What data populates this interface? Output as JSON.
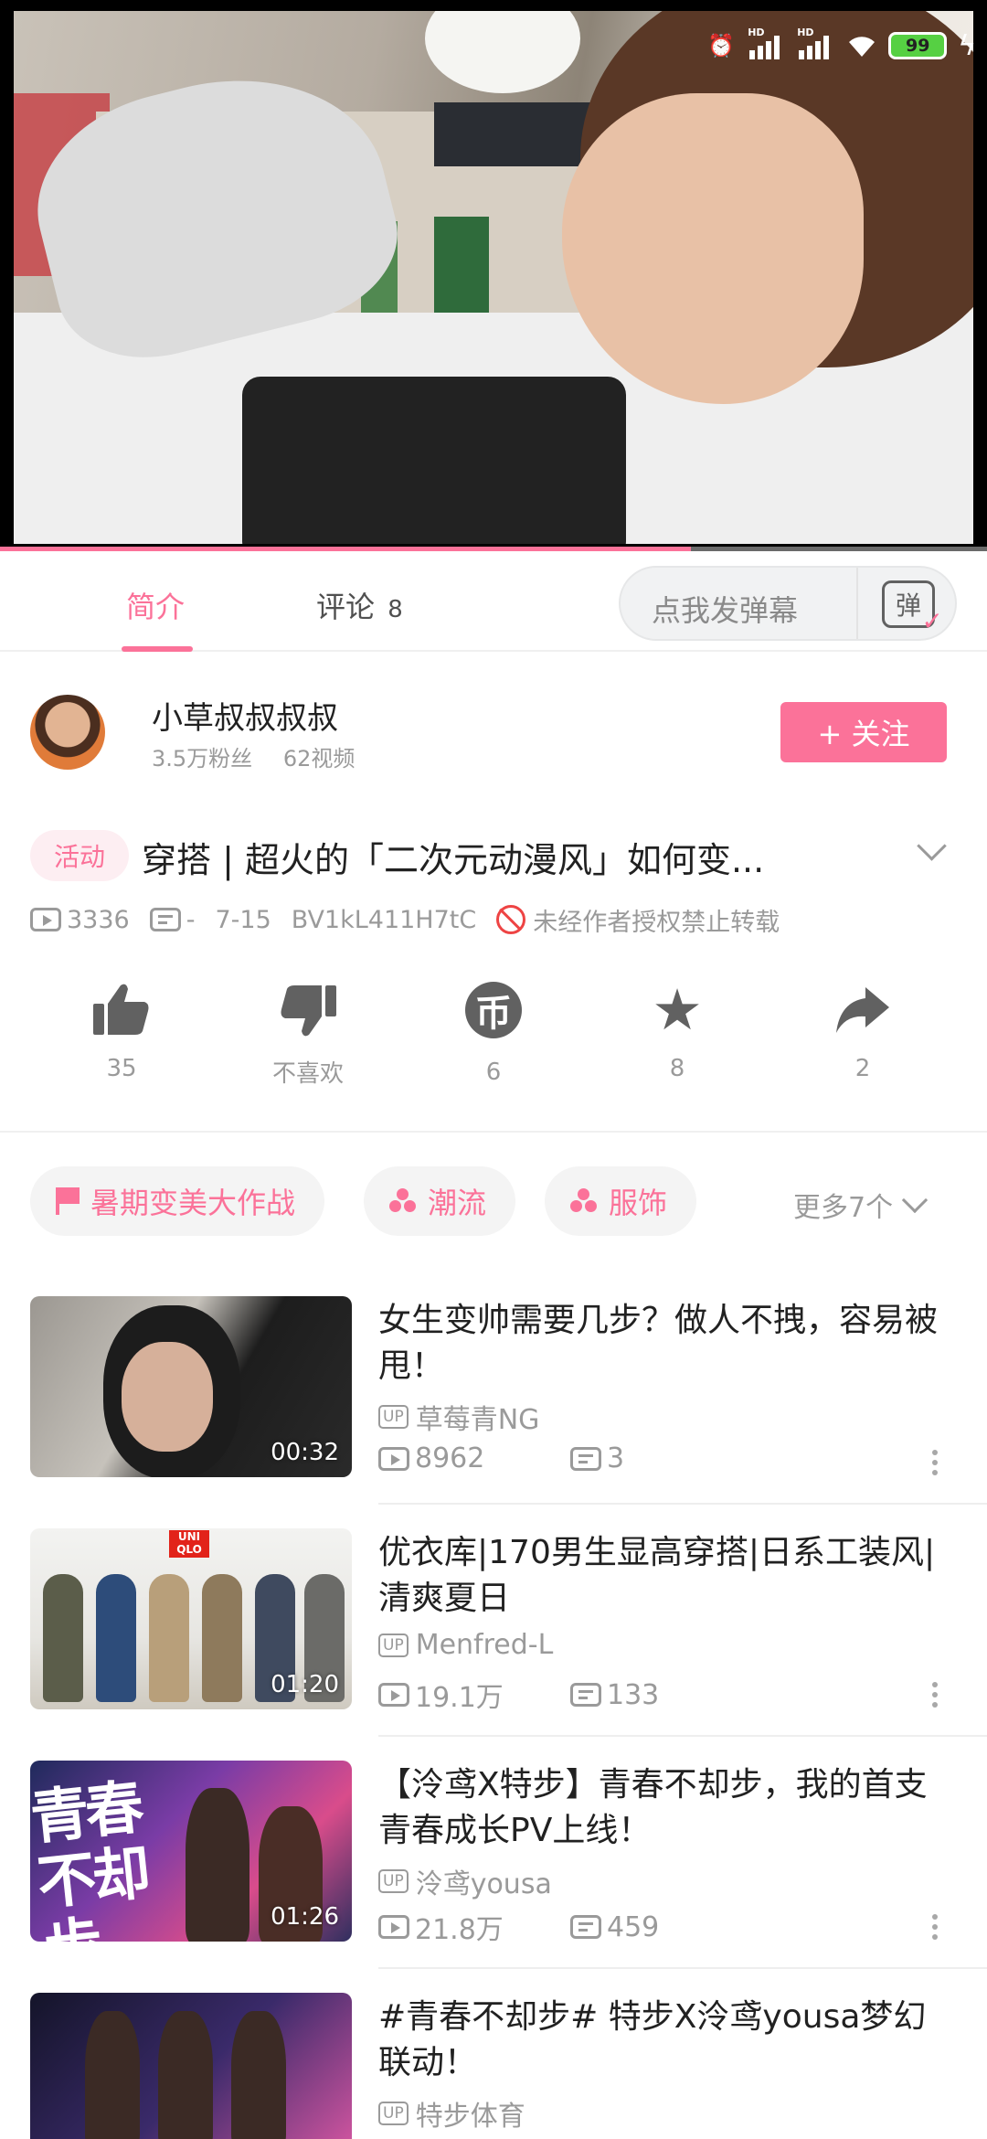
{
  "status_bar": {
    "battery": "99",
    "signal_1": "HD",
    "signal_2": "HD"
  },
  "video": {
    "progress_fraction": 0.7
  },
  "tabs": [
    {
      "label": "简介",
      "active": true
    },
    {
      "label": "评论",
      "count": "8",
      "active": false
    }
  ],
  "danmaku": {
    "placeholder": "点我发弹幕",
    "icon_text": "弹"
  },
  "uploader": {
    "name": "小草叔叔叔叔",
    "fans": "3.5万粉丝",
    "videos": "62视频",
    "follow_label": "+ 关注"
  },
  "video_info": {
    "tag": "活动",
    "title": "穿搭 | 超火的「二次元动漫风」如何变...",
    "views": "3336",
    "danmaku": "-",
    "date": "7-15",
    "bvid": "BV1kL411H7tC",
    "copyright": "未经作者授权禁止转载"
  },
  "actions": [
    {
      "name": "like",
      "label": "35"
    },
    {
      "name": "dislike",
      "label": "不喜欢"
    },
    {
      "name": "coin",
      "label": "6"
    },
    {
      "name": "favorite",
      "label": "8"
    },
    {
      "name": "share",
      "label": "2"
    }
  ],
  "tags": [
    {
      "label": "暑期变美大作战",
      "icon": "flag-icon"
    },
    {
      "label": "潮流",
      "icon": "tag-dots-icon"
    },
    {
      "label": "服饰",
      "icon": "tag-dots-icon"
    }
  ],
  "more_tags": "更多7个",
  "related": [
    {
      "title": "女生变帅需要几步？做人不拽，容易被甩！",
      "up": "草莓青NG",
      "views": "8962",
      "danmaku": "3",
      "duration": "00:32"
    },
    {
      "title": "优衣库|170男生显高穿搭|日系工装风|清爽夏日",
      "up": "Menfred-L",
      "views": "19.1万",
      "danmaku": "133",
      "duration": "01:20"
    },
    {
      "title": "【泠鸢X特步】青春不却步，我的首支青春成长PV上线！",
      "up": "泠鸢yousa",
      "views": "21.8万",
      "danmaku": "459",
      "duration": "01:26"
    },
    {
      "title": "#青春不却步# 特步X泠鸢yousa梦幻联动！",
      "up": "特步体育",
      "views": "",
      "danmaku": "",
      "duration": ""
    }
  ],
  "thumb_text": {
    "uniqlo": "UNI QLO",
    "qingchun": "青春不却步"
  },
  "up_badge": "UP"
}
